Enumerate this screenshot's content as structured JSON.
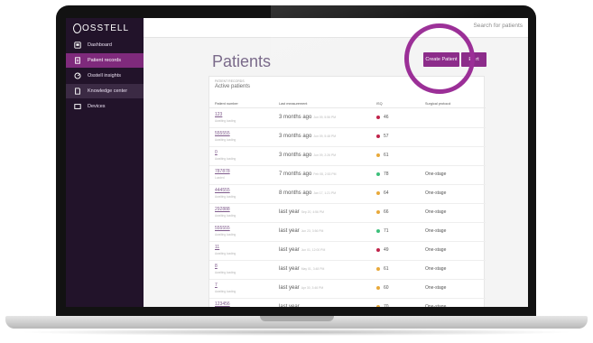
{
  "app": {
    "logo_text": "OSSTELL"
  },
  "topbar": {
    "search_placeholder": "Search for patients"
  },
  "sidebar": {
    "items": [
      {
        "label": "Dashboard",
        "icon": "dashboard-icon",
        "state": "normal"
      },
      {
        "label": "Patient records",
        "icon": "patient-records-icon",
        "state": "active"
      },
      {
        "label": "Osstell insights",
        "icon": "insights-icon",
        "state": "normal"
      },
      {
        "label": "Knowledge center",
        "icon": "book-icon",
        "state": "hover"
      },
      {
        "label": "Devices",
        "icon": "device-icon",
        "state": "normal"
      }
    ]
  },
  "page": {
    "title": "Patients",
    "create_button": "Create Patient",
    "export_button": "Ex  rt"
  },
  "card": {
    "subtitle": "PATIENT RECORDS",
    "title": "Active patients",
    "columns": [
      "Patient number",
      "Last measurement",
      "ISQ",
      "Surgical protocol"
    ]
  },
  "colors": {
    "isq_red": "#c0234a",
    "isq_yellow": "#e8a93a",
    "isq_green": "#3cbf7a",
    "accent": "#8c2c8a"
  },
  "patients": [
    {
      "number": "123",
      "status": "Awaiting loading",
      "measurement": "3 months ago",
      "date": "Jun 09, 5:56 PM",
      "isq": "46",
      "isq_color": "#c0234a",
      "protocol": ""
    },
    {
      "number": "555555",
      "status": "Awaiting loading",
      "measurement": "3 months ago",
      "date": "Jun 09, 5:48 PM",
      "isq": "57",
      "isq_color": "#c0234a",
      "protocol": ""
    },
    {
      "number": "0",
      "status": "Awaiting loading",
      "measurement": "3 months ago",
      "date": "Jun 09, 2:26 PM",
      "isq": "61",
      "isq_color": "#e8a93a",
      "protocol": ""
    },
    {
      "number": "787878",
      "status": "Loaded",
      "measurement": "7 months ago",
      "date": "Feb 08, 2:53 PM",
      "isq": "78",
      "isq_color": "#3cbf7a",
      "protocol": "One-stage"
    },
    {
      "number": "444555",
      "status": "Awaiting loading",
      "measurement": "8 months ago",
      "date": "Jan 17, 1:21 PM",
      "isq": "64",
      "isq_color": "#e8a93a",
      "protocol": "One-stage"
    },
    {
      "number": "292888",
      "status": "Awaiting loading",
      "measurement": "last year",
      "date": "Sep 20, 4:56 PM",
      "isq": "66",
      "isq_color": "#e8a93a",
      "protocol": "One-stage"
    },
    {
      "number": "555555",
      "status": "Awaiting loading",
      "measurement": "last year",
      "date": "Jun 23, 3:56 PM",
      "isq": "71",
      "isq_color": "#3cbf7a",
      "protocol": "One-stage"
    },
    {
      "number": "11",
      "status": "Awaiting loading",
      "measurement": "last year",
      "date": "Jun 01, 12:00 PM",
      "isq": "49",
      "isq_color": "#c0234a",
      "protocol": "One-stage"
    },
    {
      "number": "8",
      "status": "Awaiting loading",
      "measurement": "last year",
      "date": "May 01, 3:48 PM",
      "isq": "61",
      "isq_color": "#e8a93a",
      "protocol": "One-stage"
    },
    {
      "number": "7",
      "status": "Awaiting loading",
      "measurement": "last year",
      "date": "Apr 30, 3:46 PM",
      "isq": "60",
      "isq_color": "#e8a93a",
      "protocol": "One-stage"
    },
    {
      "number": "123456",
      "status": "",
      "measurement": "last year",
      "date": "",
      "isq": "70",
      "isq_color": "#e8a93a",
      "protocol": "One-stage"
    }
  ]
}
